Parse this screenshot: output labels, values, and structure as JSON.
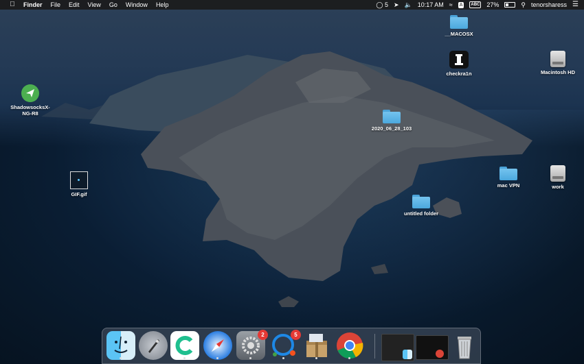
{
  "menubar": {
    "app_name": "Finder",
    "menus": [
      "File",
      "Edit",
      "View",
      "Go",
      "Window",
      "Help"
    ],
    "status": {
      "messages_count": "5",
      "battery": "27%",
      "time": "10:17 AM",
      "input_source": "ABC",
      "user": "tenorsharess"
    }
  },
  "desktop": {
    "icons": {
      "macosx": "__MACOSX",
      "checkrain": "checkra1n",
      "macintosh_hd": "Macintosh HD",
      "shadowsocks": "ShadowsocksX-NG-R8",
      "folder_2020": "2020_06_28_103",
      "gif": "GIF.gif",
      "mac_vpn": "mac VPN",
      "work": "work",
      "untitled_folder": "untitled folder"
    }
  },
  "dock": {
    "badges": {
      "system_preferences": "2",
      "messages": "5"
    }
  }
}
